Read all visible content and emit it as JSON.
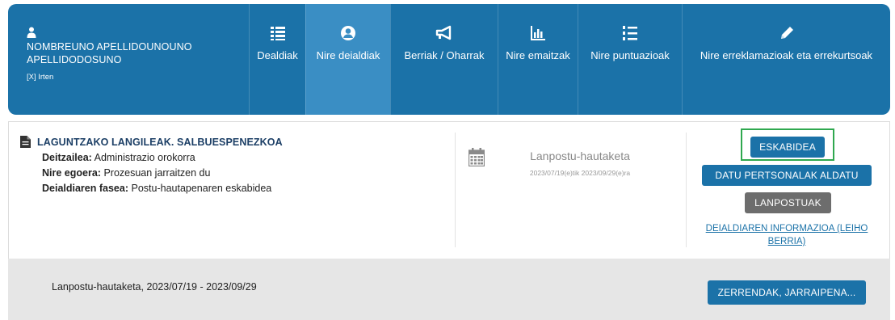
{
  "user": {
    "name": "NOMBREUNO APELLIDOUNOUNO APELLIDODOSUNO",
    "logout_label": "[X] Irten"
  },
  "nav": [
    {
      "label": "Dealdiak",
      "icon": "list-icon",
      "active": false
    },
    {
      "label": "Nire deialdiak",
      "icon": "user-circle-icon",
      "active": true
    },
    {
      "label": "Berriak / Oharrak",
      "icon": "megaphone-icon",
      "active": false
    },
    {
      "label": "Nire emaitzak",
      "icon": "bar-chart-icon",
      "active": false
    },
    {
      "label": "Nire puntuazioak",
      "icon": "numbered-list-icon",
      "active": false
    },
    {
      "label": "Nire erreklamazioak eta errekurtsoak",
      "icon": "pencil-icon",
      "active": false
    }
  ],
  "call": {
    "title": "LAGUNTZAKO LANGILEAK. SALBUESPENEZKOA",
    "convener_label": "Deitzailea:",
    "convener_value": "Administrazio orokorra",
    "status_label": "Nire egoera:",
    "status_value": "Prozesuan jarraitzen du",
    "phase_label": "Deialdiaren fasea:",
    "phase_value": "Postu-hautapenaren eskabidea"
  },
  "phase": {
    "name": "Lanpostu-hautaketa",
    "dates": "2023/07/19(e)tik 2023/09/29(e)ra"
  },
  "actions": {
    "application": "ESKABIDEA",
    "personal_data": "DATU PERTSONALAK ALDATU",
    "posts": "LANPOSTUAK",
    "info_link": "DEIALDIAREN INFORMAZIOA (LEIHO BERRIA)"
  },
  "footer": {
    "text": "Lanpostu-hautaketa, 2023/07/19 - 2023/09/29",
    "button": "ZERRENDAK, JARRAIPENA..."
  },
  "colors": {
    "primary": "#1b72a8",
    "active_tab": "#3a8ec4",
    "highlight": "#2fa84f",
    "gray_button": "#6d6d6d"
  }
}
